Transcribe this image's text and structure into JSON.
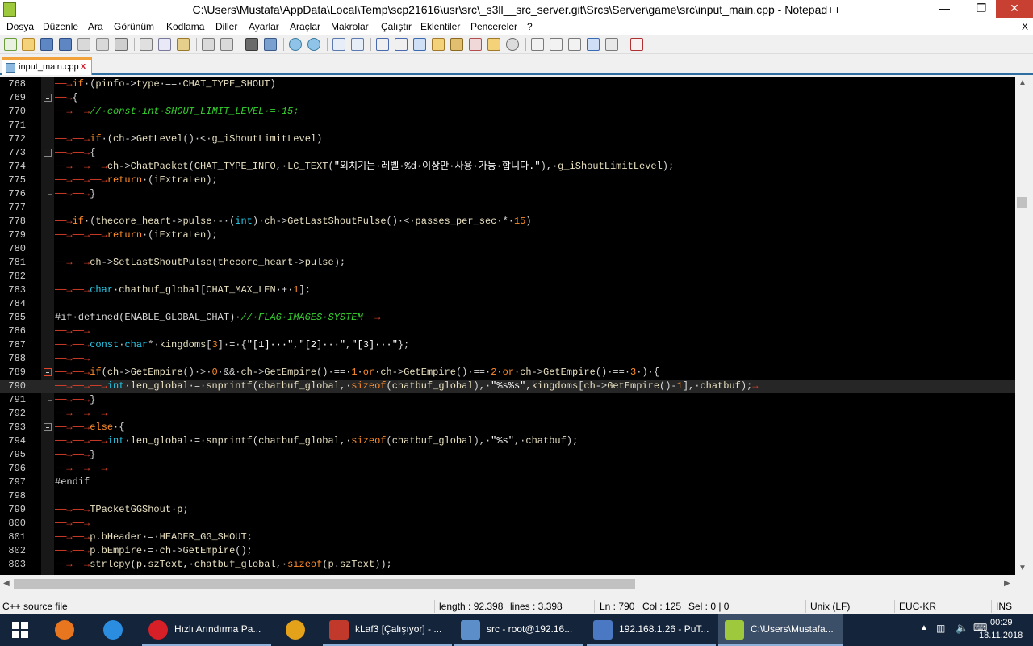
{
  "window": {
    "title": "C:\\Users\\Mustafa\\AppData\\Local\\Temp\\scp21616\\usr\\src\\_s3ll__src_server.git\\Srcs\\Server\\game\\src\\input_main.cpp - Notepad++",
    "min_glyph": "—",
    "max_glyph": "❐",
    "close_glyph": "✕"
  },
  "menu": [
    "Dosya",
    "Düzenle",
    "Ara",
    "Görünüm",
    "Kodlama",
    "Diller",
    "Ayarlar",
    "Araçlar",
    "Makrolar",
    "Çalıştır",
    "Eklentiler",
    "Pencereler",
    "?"
  ],
  "menu_close": "X",
  "tab": {
    "label": "input_main.cpp",
    "close": "x"
  },
  "lines": [
    {
      "n": "768",
      "fold": "",
      "html": "<span class='t-tab'>──→</span><span class='t-kw'>if</span><span class='t-op'>·(</span><span class='t-id'>pinfo</span><span class='t-op'>-&gt;</span><span class='t-id'>type</span><span class='t-op'>·==·</span><span class='t-id'>CHAT_TYPE_SHOUT</span><span class='t-op'>)</span>"
    },
    {
      "n": "769",
      "fold": "box",
      "html": "<span class='t-tab'>──→</span><span class='t-op'>{</span>"
    },
    {
      "n": "770",
      "fold": "line",
      "html": "<span class='t-tab'>──→──→</span><span class='t-cmt'>//·const·int·SHOUT_LIMIT_LEVEL·=·15;</span>"
    },
    {
      "n": "771",
      "fold": "line",
      "html": ""
    },
    {
      "n": "772",
      "fold": "line",
      "html": "<span class='t-tab'>──→──→</span><span class='t-kw'>if</span><span class='t-op'>·(</span><span class='t-id'>ch</span><span class='t-op'>-&gt;</span><span class='t-id'>GetLevel</span><span class='t-op'>()·&lt;·</span><span class='t-id'>g_iShoutLimitLevel</span><span class='t-op'>)</span>"
    },
    {
      "n": "773",
      "fold": "box",
      "html": "<span class='t-tab'>──→──→</span><span class='t-op'>{</span>"
    },
    {
      "n": "774",
      "fold": "line",
      "html": "<span class='t-tab'>──→──→──→</span><span class='t-id'>ch</span><span class='t-op'>-&gt;</span><span class='t-id'>ChatPacket</span><span class='t-op'>(</span><span class='t-id'>CHAT_TYPE_INFO</span><span class='t-op'>,·</span><span class='t-id'>LC_TEXT</span><span class='t-op'>(</span><span class='t-str'>\"외치기는·레벨·%d·이상만·사용·가능·합니다.\"</span><span class='t-op'>),·</span><span class='t-id'>g_iShoutLimitLevel</span><span class='t-op'>);</span>"
    },
    {
      "n": "775",
      "fold": "line",
      "html": "<span class='t-tab'>──→──→──→</span><span class='t-kw'>return</span><span class='t-op'>·(</span><span class='t-id'>iExtraLen</span><span class='t-op'>);</span>"
    },
    {
      "n": "776",
      "fold": "end",
      "html": "<span class='t-tab'>──→──→</span><span class='t-op'>}</span>"
    },
    {
      "n": "777",
      "fold": "line",
      "html": ""
    },
    {
      "n": "778",
      "fold": "line",
      "html": "<span class='t-tab'>──→</span><span class='t-kw'>if</span><span class='t-op'>·(</span><span class='t-id'>thecore_heart</span><span class='t-op'>-&gt;</span><span class='t-id'>pulse</span><span class='t-op'>·-·(</span><span class='t-ty'>int</span><span class='t-op'>)·</span><span class='t-id'>ch</span><span class='t-op'>-&gt;</span><span class='t-id'>GetLastShoutPulse</span><span class='t-op'>()·&lt;·</span><span class='t-id'>passes_per_sec</span><span class='t-op'>·*·</span><span class='t-num'>15</span><span class='t-op'>)</span>"
    },
    {
      "n": "779",
      "fold": "line",
      "html": "<span class='t-tab'>──→──→──→</span><span class='t-kw'>return</span><span class='t-op'>·(</span><span class='t-id'>iExtraLen</span><span class='t-op'>);</span>"
    },
    {
      "n": "780",
      "fold": "line",
      "html": ""
    },
    {
      "n": "781",
      "fold": "line",
      "html": "<span class='t-tab'>──→──→</span><span class='t-id'>ch</span><span class='t-op'>-&gt;</span><span class='t-id'>SetLastShoutPulse</span><span class='t-op'>(</span><span class='t-id'>thecore_heart</span><span class='t-op'>-&gt;</span><span class='t-id'>pulse</span><span class='t-op'>);</span>"
    },
    {
      "n": "782",
      "fold": "line",
      "html": ""
    },
    {
      "n": "783",
      "fold": "line",
      "html": "<span class='t-tab'>──→──→</span><span class='t-ty'>char</span><span class='t-op'>·</span><span class='t-id'>chatbuf_global</span><span class='t-op'>[</span><span class='t-id'>CHAT_MAX_LEN</span><span class='t-op'>·+·</span><span class='t-num'>1</span><span class='t-op'>];</span>"
    },
    {
      "n": "784",
      "fold": "line",
      "html": ""
    },
    {
      "n": "785",
      "fold": "line",
      "html": "<span class='t-pp'>#if·defined(ENABLE_GLOBAL_CHAT)·</span><span class='t-cmt'>//·FLAG·IMAGES·SYSTEM</span><span class='t-tab'>──→</span>"
    },
    {
      "n": "786",
      "fold": "line",
      "html": "<span class='t-tab'>──→──→</span>"
    },
    {
      "n": "787",
      "fold": "line",
      "html": "<span class='t-tab'>──→──→</span><span class='t-ty'>const</span><span class='t-op'>·</span><span class='t-ty'>char</span><span class='t-op'>*·</span><span class='t-id'>kingdoms</span><span class='t-op'>[</span><span class='t-num'>3</span><span class='t-op'>]·=·{</span><span class='t-str'>\"[1]···\"</span><span class='t-op'>,</span><span class='t-str'>\"[2]···\"</span><span class='t-op'>,</span><span class='t-str'>\"[3]···\"</span><span class='t-op'>};</span>"
    },
    {
      "n": "788",
      "fold": "line",
      "html": "<span class='t-tab'>──→──→</span>"
    },
    {
      "n": "789",
      "fold": "boxred",
      "html": "<span class='t-tab'>──→──→</span><span class='t-kw'>if</span><span class='t-op'>(</span><span class='t-id'>ch</span><span class='t-op'>-&gt;</span><span class='t-id'>GetEmpire</span><span class='t-op'>()·&gt;·</span><span class='t-num'>0</span><span class='t-op'>·&amp;&amp;·</span><span class='t-id'>ch</span><span class='t-op'>-&gt;</span><span class='t-id'>GetEmpire</span><span class='t-op'>()·==·</span><span class='t-num'>1</span><span class='t-op'>·</span><span class='t-kw'>or</span><span class='t-op'>·</span><span class='t-id'>ch</span><span class='t-op'>-&gt;</span><span class='t-id'>GetEmpire</span><span class='t-op'>()·==·</span><span class='t-num'>2</span><span class='t-op'>·</span><span class='t-kw'>or</span><span class='t-op'>·</span><span class='t-id'>ch</span><span class='t-op'>-&gt;</span><span class='t-id'>GetEmpire</span><span class='t-op'>()·==·</span><span class='t-num'>3</span><span class='t-op'>·)·{</span>"
    },
    {
      "n": "790",
      "fold": "line",
      "cur": true,
      "html": "<span class='t-tab'>──→──→──→</span><span class='t-ty'>int</span><span class='t-op'>·</span><span class='t-id'>len_global</span><span class='t-op'>·=·</span><span class='t-id'>snprintf</span><span class='t-op'>(</span><span class='t-id'>chatbuf_global</span><span class='t-op'>,·</span><span class='t-kw'>sizeof</span><span class='t-op'>(</span><span class='t-id'>chatbuf_global</span><span class='t-op'>),·</span><span class='t-str'>\"%s%s\"</span><span class='t-op'>,</span><span class='t-id'>kingdoms</span><span class='t-op'>[</span><span class='t-id'>ch</span><span class='t-op'>-&gt;</span><span class='t-id'>GetEmpire</span><span class='t-op'>()-</span><span class='t-num'>1</span><span class='t-op'>],·</span><span class='t-id'>chatbuf</span><span class='t-op'>);</span><span class='t-tab'>→</span>"
    },
    {
      "n": "791",
      "fold": "end",
      "html": "<span class='t-tab'>──→──→</span><span class='t-op'>}</span>"
    },
    {
      "n": "792",
      "fold": "line",
      "html": "<span class='t-tab'>──→──→──→</span>"
    },
    {
      "n": "793",
      "fold": "box",
      "html": "<span class='t-tab'>──→──→</span><span class='t-kw'>else</span><span class='t-op'>·{</span>"
    },
    {
      "n": "794",
      "fold": "line",
      "html": "<span class='t-tab'>──→──→──→</span><span class='t-ty'>int</span><span class='t-op'>·</span><span class='t-id'>len_global</span><span class='t-op'>·=·</span><span class='t-id'>snprintf</span><span class='t-op'>(</span><span class='t-id'>chatbuf_global</span><span class='t-op'>,·</span><span class='t-kw'>sizeof</span><span class='t-op'>(</span><span class='t-id'>chatbuf_global</span><span class='t-op'>),·</span><span class='t-str'>\"%s\"</span><span class='t-op'>,·</span><span class='t-id'>chatbuf</span><span class='t-op'>);</span>"
    },
    {
      "n": "795",
      "fold": "end",
      "html": "<span class='t-tab'>──→──→</span><span class='t-op'>}</span>"
    },
    {
      "n": "796",
      "fold": "line",
      "html": "<span class='t-tab'>──→──→──→</span>"
    },
    {
      "n": "797",
      "fold": "line",
      "html": "<span class='t-pp'>#endif</span>"
    },
    {
      "n": "798",
      "fold": "line",
      "html": ""
    },
    {
      "n": "799",
      "fold": "line",
      "html": "<span class='t-tab'>──→──→</span><span class='t-id'>TPacketGGShout</span><span class='t-op'>·</span><span class='t-id'>p</span><span class='t-op'>;</span>"
    },
    {
      "n": "800",
      "fold": "line",
      "html": "<span class='t-tab'>──→──→</span>"
    },
    {
      "n": "801",
      "fold": "line",
      "html": "<span class='t-tab'>──→──→</span><span class='t-id'>p</span><span class='t-op'>.</span><span class='t-id'>bHeader</span><span class='t-op'>·=·</span><span class='t-id'>HEADER_GG_SHOUT</span><span class='t-op'>;</span>"
    },
    {
      "n": "802",
      "fold": "line",
      "html": "<span class='t-tab'>──→──→</span><span class='t-id'>p</span><span class='t-op'>.</span><span class='t-id'>bEmpire</span><span class='t-op'>·=·</span><span class='t-id'>ch</span><span class='t-op'>-&gt;</span><span class='t-id'>GetEmpire</span><span class='t-op'>();</span>"
    },
    {
      "n": "803",
      "fold": "line",
      "html": "<span class='t-tab'>──→──→</span><span class='t-id'>strlcpy</span><span class='t-op'>(</span><span class='t-id'>p</span><span class='t-op'>.</span><span class='t-id'>szText</span><span class='t-op'>,·</span><span class='t-id'>chatbuf_global</span><span class='t-op'>,·</span><span class='t-kw'>sizeof</span><span class='t-op'>(</span><span class='t-id'>p</span><span class='t-op'>.</span><span class='t-id'>szText</span><span class='t-op'>));</span>"
    }
  ],
  "status": {
    "type": "C++ source file",
    "length": "length : 92.398",
    "lines": "lines : 3.398",
    "ln": "Ln : 790",
    "col": "Col : 125",
    "sel": "Sel : 0 | 0",
    "eol": "Unix (LF)",
    "enc": "EUC-KR",
    "ins": "INS"
  },
  "taskbar": {
    "items": [
      {
        "label": "Hızlı Arındırma Pa...",
        "color": "#d61f26"
      },
      {
        "label": "",
        "color": "#e3a21a"
      },
      {
        "label": "kLaf3 [Çalışıyor] - ...",
        "color": "#c0392b"
      },
      {
        "label": "src - root@192.16...",
        "color": "#5c8fc9"
      },
      {
        "label": "192.168.1.26 - PuT...",
        "color": "#4a78c2"
      },
      {
        "label": "C:\\Users\\Mustafa...",
        "color": "#9ec93c"
      }
    ],
    "time": "00:29",
    "date": "18.11.2018"
  }
}
